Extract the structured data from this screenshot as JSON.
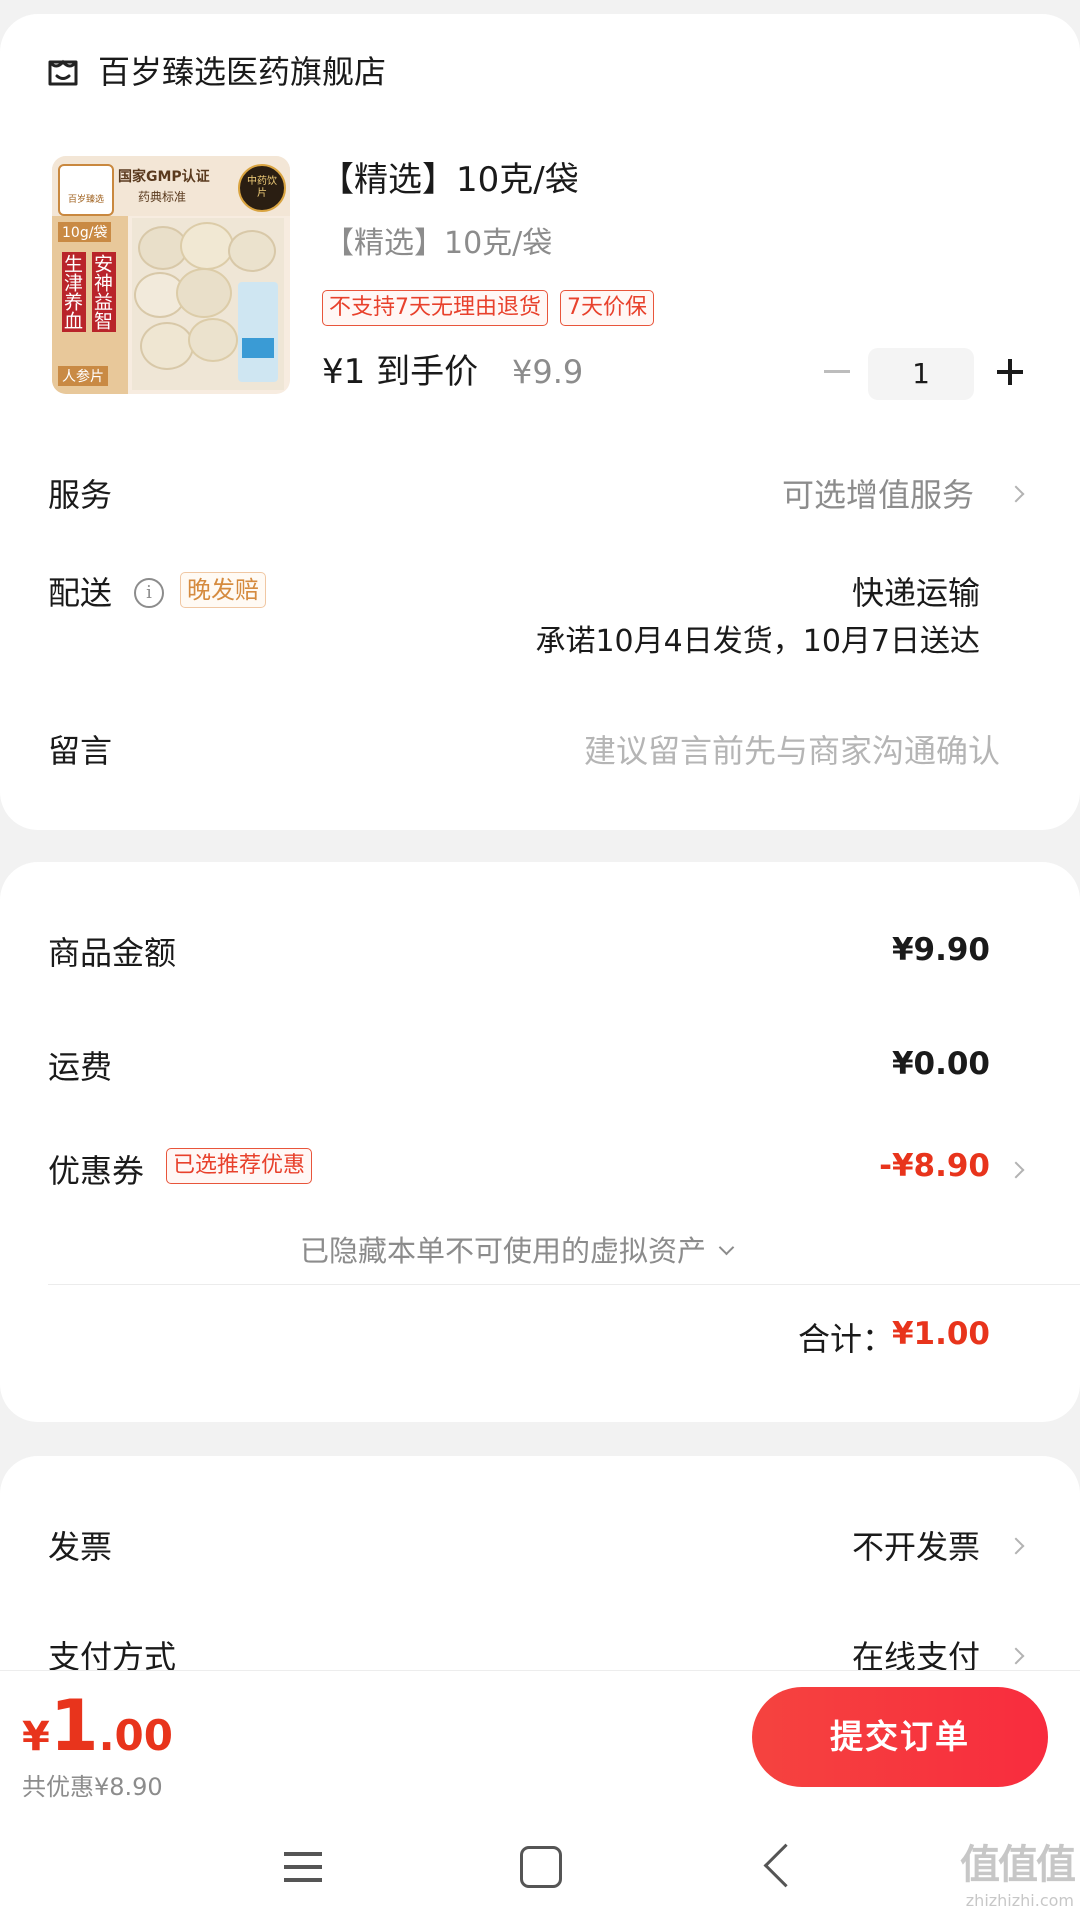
{
  "store": {
    "name": "百岁臻选医药旗舰店",
    "icon": "store-icon"
  },
  "product": {
    "image_texts": {
      "brand": "百岁臻选",
      "cert_line1": "国家GMP认证",
      "cert_line2": "药典标准",
      "seal": "中药饮片",
      "spec": "10g/袋",
      "benefit_left": "生津养血",
      "benefit_right": "安神益智",
      "name": "人参片"
    },
    "title": "【精选】10克/袋",
    "spec": "【精选】10克/袋",
    "tags": [
      "不支持7天无理由退货",
      "7天价保"
    ],
    "price_label": "¥1 到手价",
    "original_price": "¥9.9",
    "quantity": "1"
  },
  "service": {
    "label": "服务",
    "value": "可选增值服务"
  },
  "delivery": {
    "label": "配送",
    "tag": "晚发赔",
    "method": "快递运输",
    "promise": "承诺10月4日发货，10月7日送达"
  },
  "message": {
    "label": "留言",
    "placeholder": "建议留言前先与商家沟通确认"
  },
  "summary": {
    "goods_label": "商品金额",
    "goods_value": "¥9.90",
    "shipping_label": "运费",
    "shipping_value": "¥0.00",
    "coupon_label": "优惠券",
    "coupon_tag": "已选推荐优惠",
    "coupon_value": "-¥8.90",
    "hidden_assets": "已隐藏本单不可使用的虚拟资产",
    "total_label": "合计：",
    "total_value": "¥1.00"
  },
  "invoice": {
    "label": "发票",
    "value": "不开发票"
  },
  "payment": {
    "label": "支付方式",
    "value": "在线支付"
  },
  "bottom_bar": {
    "currency": "¥",
    "price_int": "1",
    "price_dec": ".00",
    "discount": "共优惠¥8.90",
    "submit": "提交订单"
  },
  "watermark": {
    "text": "值值值",
    "url": "zhizhizhi.com"
  },
  "colors": {
    "accent": "#e8341c",
    "submit_gradient": [
      "#f5433f",
      "#f82c3e"
    ],
    "background": "#f2f2f2"
  }
}
